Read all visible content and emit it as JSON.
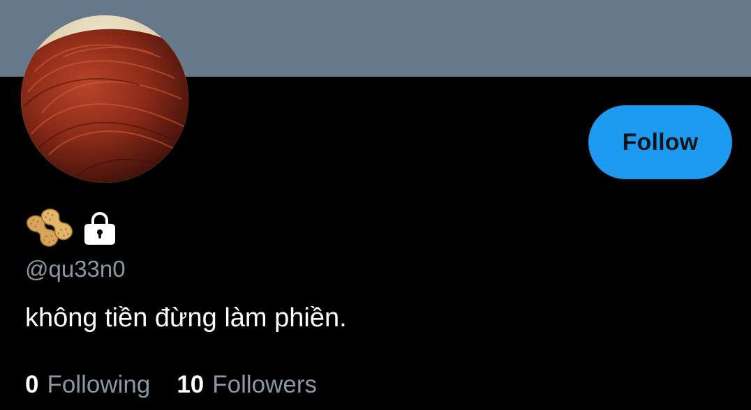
{
  "profile": {
    "handle": "@qu33n0",
    "bio": "không tiền đừng làm phiền.",
    "name_icons": [
      "peanut-icon",
      "lock-icon"
    ],
    "protected": true
  },
  "actions": {
    "follow_label": "Follow"
  },
  "stats": {
    "following_count": "0",
    "following_label": "Following",
    "followers_count": "10",
    "followers_label": "Followers"
  },
  "colors": {
    "banner": "#66788a",
    "background": "#000000",
    "accent": "#1d9bf0",
    "secondary_text": "#8b98a5",
    "primary_text": "#ffffff"
  }
}
